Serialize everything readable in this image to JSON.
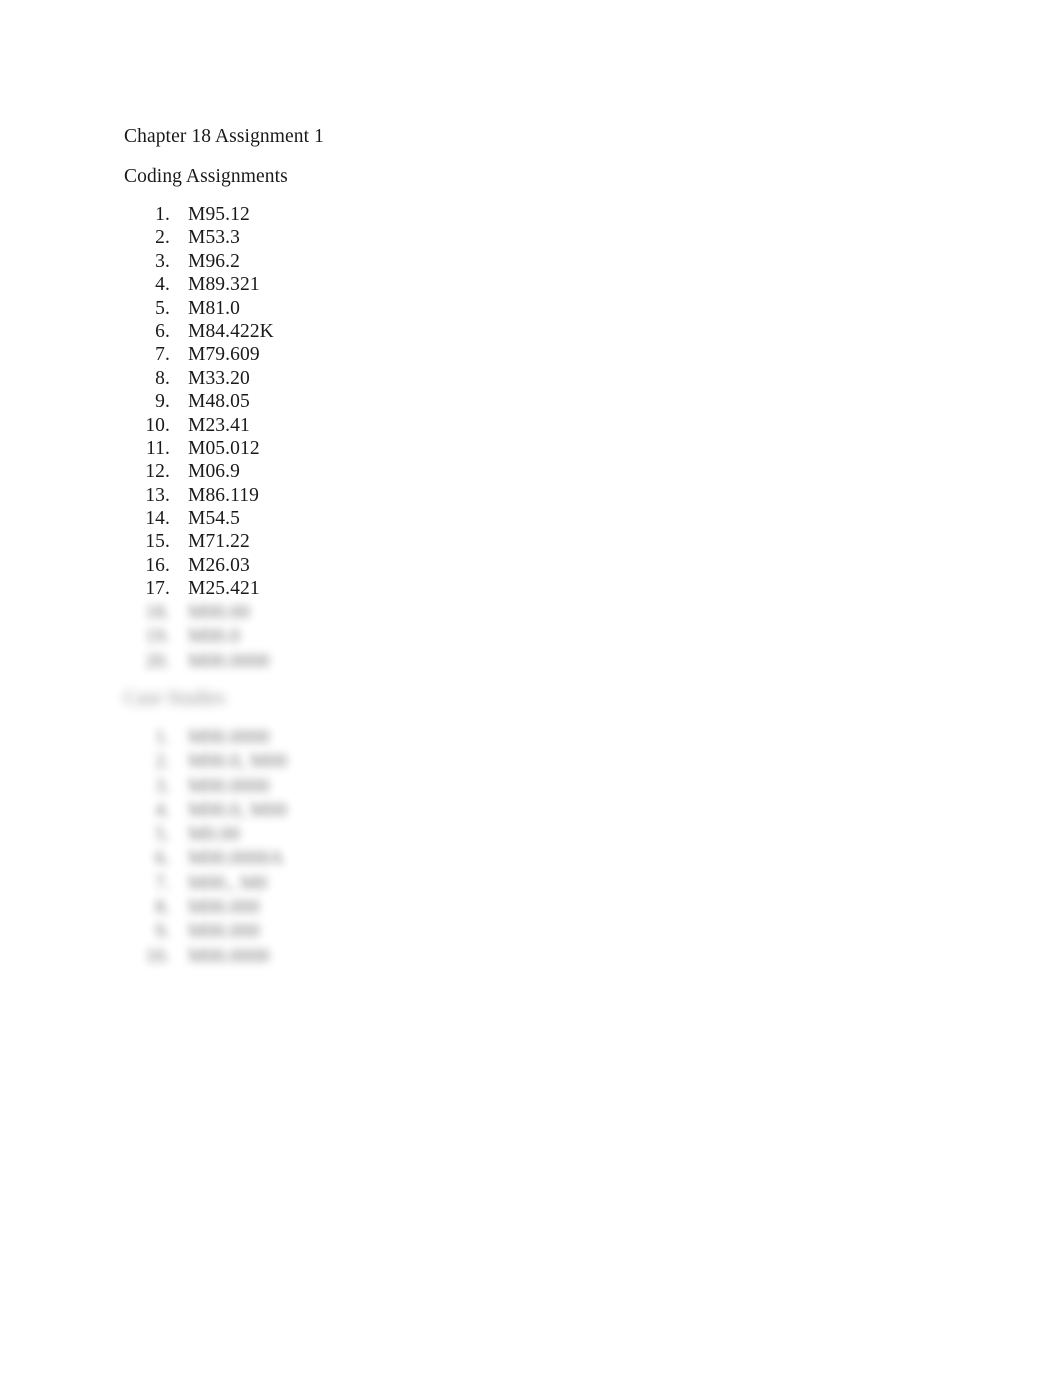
{
  "document": {
    "title": "Chapter 18 Assignment 1",
    "background_color": "#ffffff",
    "text_color": "#1a1a1a"
  },
  "sections": [
    {
      "heading": "Coding Assignments",
      "visible": true,
      "items": [
        {
          "number": "1.",
          "code": "M95.12"
        },
        {
          "number": "2.",
          "code": "M53.3"
        },
        {
          "number": "3.",
          "code": "M96.2"
        },
        {
          "number": "4.",
          "code": "M89.321"
        },
        {
          "number": "5.",
          "code": "M81.0"
        },
        {
          "number": "6.",
          "code": "M84.422K"
        },
        {
          "number": "7.",
          "code": "M79.609"
        },
        {
          "number": "8.",
          "code": "M33.20"
        },
        {
          "number": "9.",
          "code": "M48.05"
        },
        {
          "number": "10.",
          "code": "M23.41"
        },
        {
          "number": "11.",
          "code": "M05.012"
        },
        {
          "number": "12.",
          "code": "M06.9"
        },
        {
          "number": "13.",
          "code": "M86.119"
        },
        {
          "number": "14.",
          "code": "M54.5"
        },
        {
          "number": "15.",
          "code": "M71.22"
        },
        {
          "number": "16.",
          "code": "M26.03"
        },
        {
          "number": "17.",
          "code": "M25.421"
        }
      ],
      "obscured_items": [
        {
          "number": "18.",
          "code": "M00.00"
        },
        {
          "number": "19.",
          "code": "M00.0"
        },
        {
          "number": "20.",
          "code": "M00.0000"
        }
      ]
    },
    {
      "heading": "Case Studies",
      "visible": false,
      "items": [
        {
          "number": "1.",
          "code": "M00.0000"
        },
        {
          "number": "2.",
          "code": "M00.0, M00"
        },
        {
          "number": "3.",
          "code": "M00.0000"
        },
        {
          "number": "4.",
          "code": "M00.0, M00"
        },
        {
          "number": "5.",
          "code": "M0.00"
        },
        {
          "number": "6.",
          "code": "M00.0000A"
        },
        {
          "number": "7.",
          "code": "M00., M0"
        },
        {
          "number": "8.",
          "code": "M00.000"
        },
        {
          "number": "9.",
          "code": "M00.000"
        },
        {
          "number": "10.",
          "code": "M00.0000"
        }
      ]
    }
  ]
}
